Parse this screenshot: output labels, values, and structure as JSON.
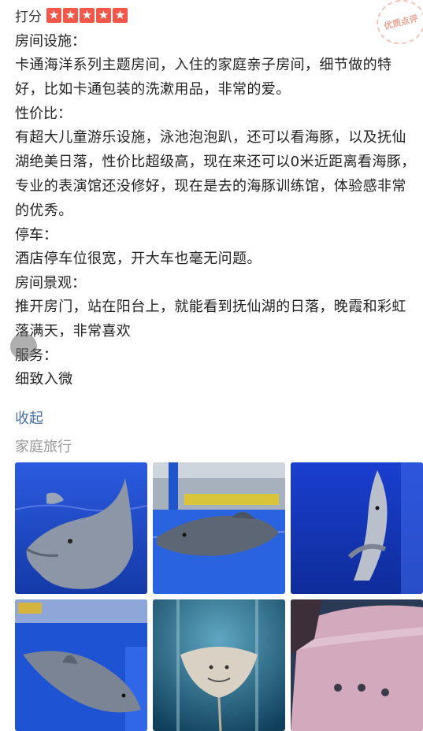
{
  "rating": {
    "label": "打分",
    "stars": 5,
    "star_glyph": "★"
  },
  "stamp": {
    "text": "优质点评"
  },
  "review": {
    "facilities_heading": "房间设施：",
    "facilities_text": "卡通海洋系列主题房间，入住的家庭亲子房间，细节做的特好，比如卡通包装的洗漱用品，非常的爱。",
    "value_heading": "性价比：",
    "value_text": "有超大儿童游乐设施，泳池泡泡趴，还可以看海豚，以及抚仙湖绝美日落，性价比超级高，现在来还可以0米近距离看海豚，专业的表演馆还没修好，现在是去的海豚训练馆，体验感非常的优秀。",
    "parking_heading": "停车：",
    "parking_text": "酒店停车位很宽，开大车也毫无问题。",
    "view_heading": "房间景观：",
    "view_text": "推开房门，站在阳台上，就能看到抚仙湖的日落，晚霞和彩虹落满天，非常喜欢",
    "service_heading": "服务：",
    "service_text": "细致入微"
  },
  "collapse_label": "收起",
  "trip_tag": "家庭旅行",
  "colors": {
    "star_red": "#f2574a",
    "link_blue": "#4a6fa5",
    "pool_blue": "#1f4fd6"
  },
  "photos": [
    {
      "subject": "dolphin-close-up"
    },
    {
      "subject": "dolphin-in-training-pool"
    },
    {
      "subject": "dolphin-underwater"
    },
    {
      "subject": "dolphin-swimming"
    },
    {
      "subject": "stingray-in-aquarium"
    },
    {
      "subject": "stingray-close-up"
    }
  ]
}
